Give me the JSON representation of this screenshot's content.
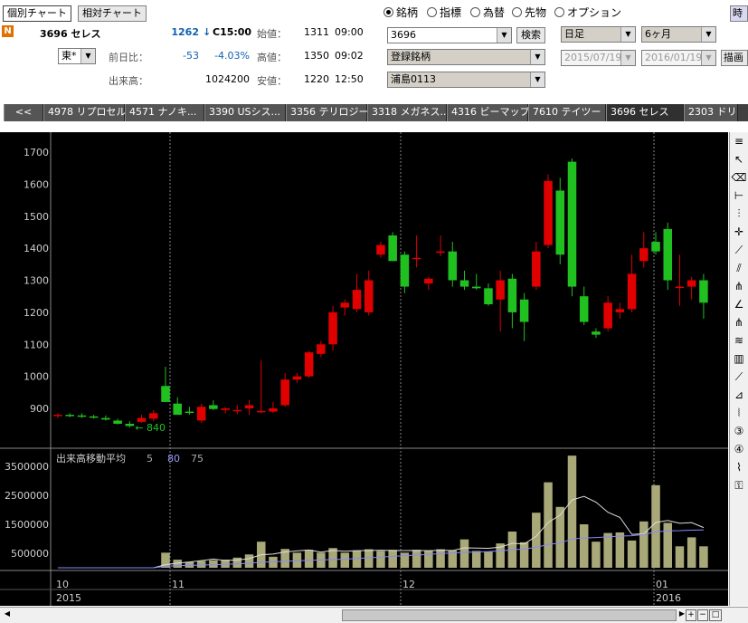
{
  "header": {
    "chart_buttons": [
      "個別チャート",
      "相対チャート"
    ],
    "n_badge": "N",
    "stock_name": "3696 セレス",
    "price": "1262",
    "arrow": "↓",
    "time": "C15:00",
    "exchange": "東*",
    "prev_label": "前日比：",
    "change": "-53",
    "change_pct": "-4.03%",
    "volume_label": "出来高：",
    "volume": "1024200",
    "open_label": "始値：",
    "open": "1311",
    "open_time": "09:00",
    "high_label": "高値：",
    "high": "1350",
    "high_time": "09:02",
    "low_label": "安値：",
    "low": "1220",
    "low_time": "12:50"
  },
  "radios": {
    "options": [
      "銘柄",
      "指標",
      "為替",
      "先物",
      "オプション"
    ],
    "selected": 0
  },
  "search": {
    "code_value": "3696",
    "search_button": "検索",
    "list_value": "登録銘柄",
    "group_value": "浦島0113"
  },
  "period": {
    "interval": "日足",
    "range": "6ヶ月",
    "from": "2015/07/19",
    "to": "2016/01/19",
    "draw_button": "描画",
    "corner_label": "時"
  },
  "tabs": [
    "<<",
    "4978 リプロセル",
    "4571 ナノキ...",
    "3390 USシス...",
    "3356 テリロジー",
    "3318 メガネス...",
    "4316 ビーマップ",
    "7610 テイツー",
    "3696 セレス",
    "2303 ドリ"
  ],
  "active_tab": 8,
  "colors": {
    "up": "#e00000",
    "down": "#20c020",
    "volume": "#a8a878"
  },
  "chart_data": [
    {
      "type": "candlestick",
      "ylim": [
        800,
        1750
      ],
      "yticks": [
        900,
        1000,
        1100,
        1200,
        1300,
        1400,
        1500,
        1600,
        1700
      ],
      "x_month_labels": [
        "10",
        "11",
        "12",
        "01"
      ],
      "x_year_labels": [
        "2015",
        "2016"
      ],
      "low_marker": "840",
      "candles": [
        {
          "o": 880,
          "h": 885,
          "l": 870,
          "c": 880
        },
        {
          "o": 880,
          "h": 885,
          "l": 872,
          "c": 878
        },
        {
          "o": 878,
          "h": 885,
          "l": 870,
          "c": 875
        },
        {
          "o": 875,
          "h": 880,
          "l": 868,
          "c": 872
        },
        {
          "o": 870,
          "h": 878,
          "l": 862,
          "c": 865
        },
        {
          "o": 862,
          "h": 868,
          "l": 850,
          "c": 852
        },
        {
          "o": 852,
          "h": 860,
          "l": 840,
          "c": 845
        },
        {
          "o": 858,
          "h": 880,
          "l": 855,
          "c": 870
        },
        {
          "o": 868,
          "h": 895,
          "l": 860,
          "c": 885
        },
        {
          "o": 970,
          "h": 1030,
          "l": 940,
          "c": 920
        },
        {
          "o": 915,
          "h": 935,
          "l": 895,
          "c": 880
        },
        {
          "o": 890,
          "h": 905,
          "l": 880,
          "c": 888
        },
        {
          "o": 862,
          "h": 915,
          "l": 855,
          "c": 905
        },
        {
          "o": 910,
          "h": 925,
          "l": 895,
          "c": 898
        },
        {
          "o": 895,
          "h": 905,
          "l": 885,
          "c": 900
        },
        {
          "o": 895,
          "h": 910,
          "l": 882,
          "c": 895
        },
        {
          "o": 900,
          "h": 925,
          "l": 880,
          "c": 910
        },
        {
          "o": 892,
          "h": 1050,
          "l": 885,
          "c": 892
        },
        {
          "o": 890,
          "h": 920,
          "l": 885,
          "c": 900
        },
        {
          "o": 910,
          "h": 1010,
          "l": 905,
          "c": 990
        },
        {
          "o": 990,
          "h": 1010,
          "l": 980,
          "c": 1000
        },
        {
          "o": 1000,
          "h": 1080,
          "l": 995,
          "c": 1075
        },
        {
          "o": 1070,
          "h": 1110,
          "l": 1060,
          "c": 1100
        },
        {
          "o": 1100,
          "h": 1220,
          "l": 1080,
          "c": 1200
        },
        {
          "o": 1215,
          "h": 1240,
          "l": 1190,
          "c": 1230
        },
        {
          "o": 1210,
          "h": 1320,
          "l": 1200,
          "c": 1270
        },
        {
          "o": 1200,
          "h": 1330,
          "l": 1190,
          "c": 1300
        },
        {
          "o": 1380,
          "h": 1420,
          "l": 1370,
          "c": 1410
        },
        {
          "o": 1440,
          "h": 1450,
          "l": 1360,
          "c": 1360
        },
        {
          "o": 1380,
          "h": 1390,
          "l": 1260,
          "c": 1280
        },
        {
          "o": 1370,
          "h": 1440,
          "l": 1340,
          "c": 1370
        },
        {
          "o": 1290,
          "h": 1310,
          "l": 1270,
          "c": 1305
        },
        {
          "o": 1390,
          "h": 1440,
          "l": 1375,
          "c": 1390
        },
        {
          "o": 1390,
          "h": 1420,
          "l": 1280,
          "c": 1300
        },
        {
          "o": 1300,
          "h": 1330,
          "l": 1270,
          "c": 1280
        },
        {
          "o": 1280,
          "h": 1320,
          "l": 1270,
          "c": 1275
        },
        {
          "o": 1275,
          "h": 1290,
          "l": 1220,
          "c": 1225
        },
        {
          "o": 1240,
          "h": 1330,
          "l": 1140,
          "c": 1300
        },
        {
          "o": 1305,
          "h": 1320,
          "l": 1150,
          "c": 1200
        },
        {
          "o": 1240,
          "h": 1260,
          "l": 1110,
          "c": 1170
        },
        {
          "o": 1280,
          "h": 1420,
          "l": 1270,
          "c": 1390
        },
        {
          "o": 1410,
          "h": 1630,
          "l": 1400,
          "c": 1610
        },
        {
          "o": 1580,
          "h": 1620,
          "l": 1350,
          "c": 1380
        },
        {
          "o": 1670,
          "h": 1680,
          "l": 1250,
          "c": 1280
        },
        {
          "o": 1250,
          "h": 1280,
          "l": 1160,
          "c": 1170
        },
        {
          "o": 1140,
          "h": 1150,
          "l": 1120,
          "c": 1130
        },
        {
          "o": 1150,
          "h": 1250,
          "l": 1140,
          "c": 1230
        },
        {
          "o": 1200,
          "h": 1230,
          "l": 1180,
          "c": 1210
        },
        {
          "o": 1210,
          "h": 1380,
          "l": 1200,
          "c": 1320
        },
        {
          "o": 1360,
          "h": 1450,
          "l": 1340,
          "c": 1400
        },
        {
          "o": 1420,
          "h": 1450,
          "l": 1380,
          "c": 1390
        },
        {
          "o": 1460,
          "h": 1480,
          "l": 1270,
          "c": 1300
        },
        {
          "o": 1280,
          "h": 1380,
          "l": 1220,
          "c": 1280
        },
        {
          "o": 1280,
          "h": 1310,
          "l": 1240,
          "c": 1300
        },
        {
          "o": 1300,
          "h": 1320,
          "l": 1180,
          "c": 1230
        }
      ]
    },
    {
      "type": "bar",
      "title": "出来高移動平均",
      "ma_periods": [
        "5",
        "80",
        "75"
      ],
      "yticks": [
        500000,
        1500000,
        2500000,
        3500000
      ],
      "ylim": [
        0,
        4200000
      ],
      "values": [
        0,
        0,
        0,
        0,
        0,
        0,
        0,
        0,
        0,
        520000,
        280000,
        200000,
        240000,
        260000,
        280000,
        350000,
        460000,
        900000,
        380000,
        650000,
        520000,
        620000,
        520000,
        680000,
        520000,
        600000,
        640000,
        580000,
        620000,
        520000,
        620000,
        600000,
        640000,
        600000,
        980000,
        580000,
        560000,
        840000,
        1250000,
        880000,
        1900000,
        2950000,
        2100000,
        3870000,
        1500000,
        900000,
        1200000,
        1220000,
        940000,
        1600000,
        2850000,
        1550000,
        740000,
        1050000,
        740000
      ]
    }
  ]
}
